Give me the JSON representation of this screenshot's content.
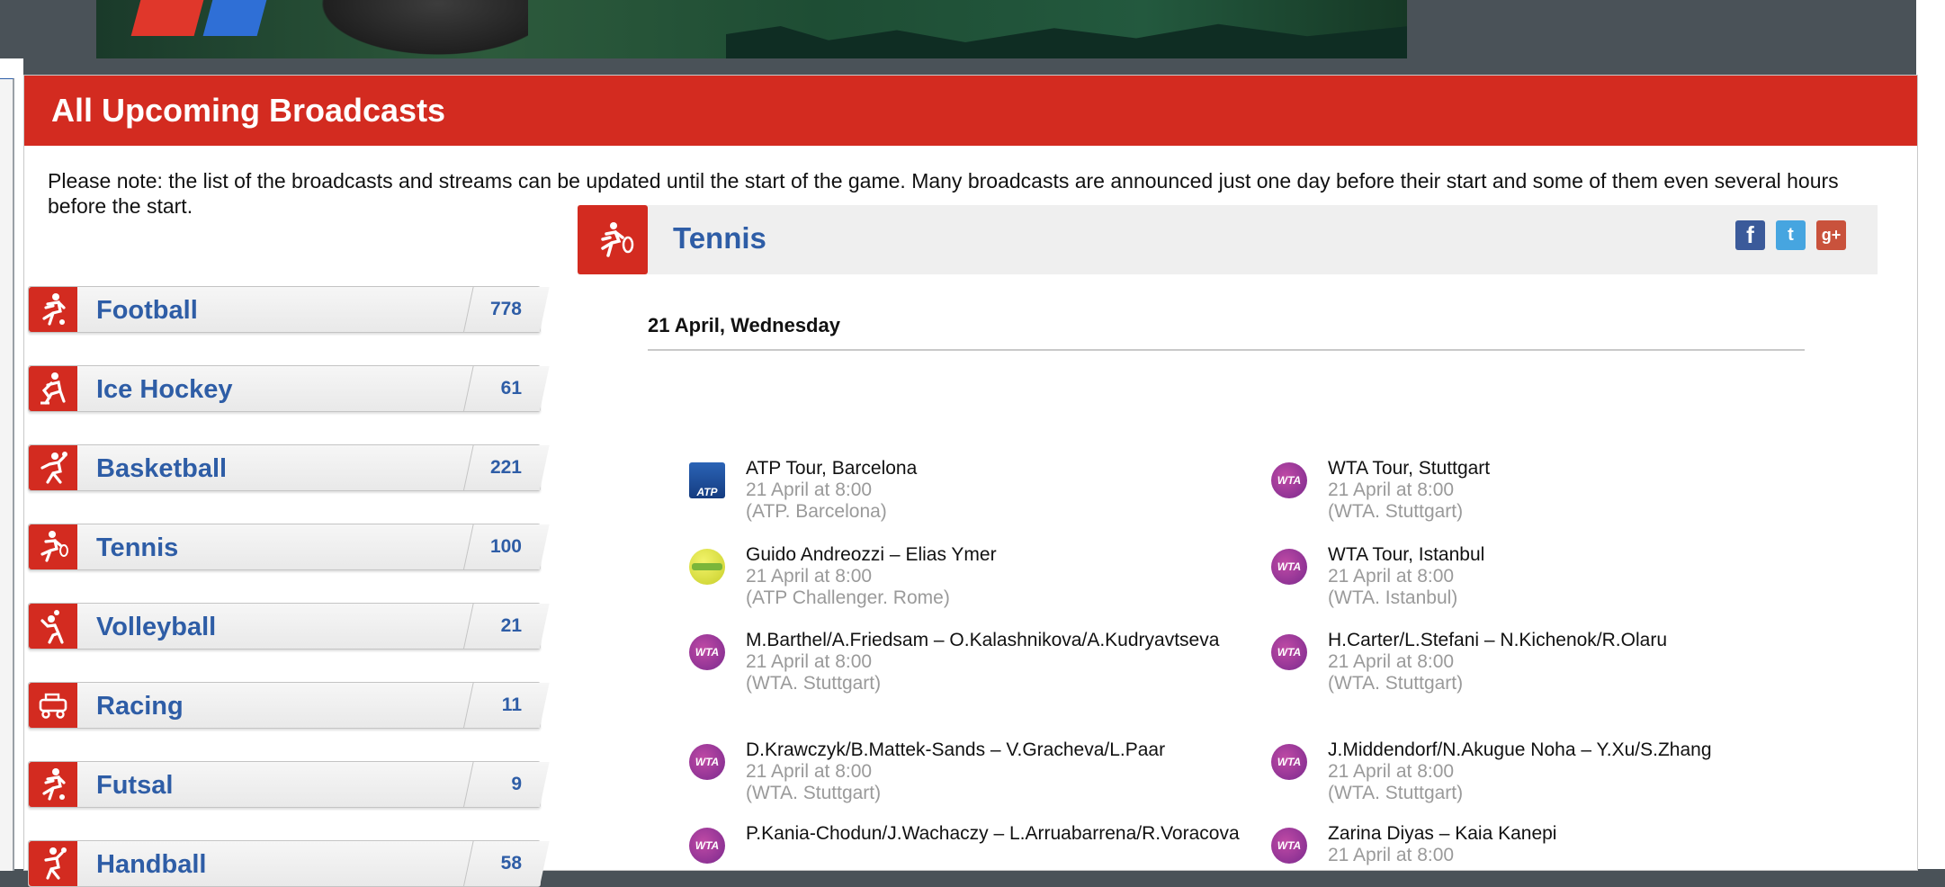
{
  "panel": {
    "title": "All Upcoming Broadcasts",
    "notice": "Please note: the list of the broadcasts and streams can be updated until the start of the game. Many broadcasts are announced just one day before their start and some of them even several hours before the start."
  },
  "sidebar": {
    "items": [
      {
        "label": "Football",
        "count": "778",
        "icon": "football-icon"
      },
      {
        "label": "Ice Hockey",
        "count": "61",
        "icon": "ice-hockey-icon"
      },
      {
        "label": "Basketball",
        "count": "221",
        "icon": "basketball-icon"
      },
      {
        "label": "Tennis",
        "count": "100",
        "icon": "tennis-icon"
      },
      {
        "label": "Volleyball",
        "count": "21",
        "icon": "volleyball-icon"
      },
      {
        "label": "Racing",
        "count": "11",
        "icon": "racing-icon"
      },
      {
        "label": "Futsal",
        "count": "9",
        "icon": "futsal-icon"
      },
      {
        "label": "Handball",
        "count": "58",
        "icon": "handball-icon"
      }
    ]
  },
  "section": {
    "title": "Tennis",
    "share": {
      "facebook": "f",
      "twitter": "t",
      "google_plus": "g+"
    },
    "day": "21 April, Wednesday",
    "events": [
      {
        "logo": "atp",
        "logo_text": "ATP",
        "title": "ATP Tour, Barcelona",
        "time": "21 April at 8:00",
        "league": "(ATP. Barcelona)"
      },
      {
        "logo": "wta",
        "logo_text": "WTA",
        "title": "WTA Tour, Stuttgart",
        "time": "21 April at 8:00",
        "league": "(WTA. Stuttgart)"
      },
      {
        "logo": "ball",
        "logo_text": "",
        "title": "Guido Andreozzi – Elias Ymer",
        "time": "21 April at 8:00",
        "league": "(ATP Challenger. Rome)"
      },
      {
        "logo": "wta",
        "logo_text": "WTA",
        "title": "WTA Tour, Istanbul",
        "time": "21 April at 8:00",
        "league": "(WTA. Istanbul)"
      },
      {
        "logo": "wta",
        "logo_text": "WTA",
        "title": "M.Barthel/A.Friedsam – O.Kalashnikova/A.Kudryavtseva",
        "time": "21 April at 8:00",
        "league": "(WTA. Stuttgart)"
      },
      {
        "logo": "wta",
        "logo_text": "WTA",
        "title": "H.Carter/L.Stefani – N.Kichenok/R.Olaru",
        "time": "21 April at 8:00",
        "league": "(WTA. Stuttgart)"
      },
      {
        "logo": "wta",
        "logo_text": "WTA",
        "title": "D.Krawczyk/B.Mattek-Sands – V.Gracheva/L.Paar",
        "time": "21 April at 8:00",
        "league": "(WTA. Stuttgart)"
      },
      {
        "logo": "wta",
        "logo_text": "WTA",
        "title": "J.Middendorf/N.Akugue Noha – Y.Xu/S.Zhang",
        "time": "21 April at 8:00",
        "league": "(WTA. Stuttgart)"
      },
      {
        "logo": "wta",
        "logo_text": "WTA",
        "title": "P.Kania-Chodun/J.Wachaczy – L.Arruabarrena/R.Voracova",
        "time": "",
        "league": ""
      },
      {
        "logo": "wta",
        "logo_text": "WTA",
        "title": "Zarina Diyas – Kaia Kanepi",
        "time": "21 April at 8:00",
        "league": ""
      }
    ]
  },
  "colors": {
    "accent_red": "#d32b20",
    "link_blue": "#2e5da6",
    "muted_gray": "#9a9a9a"
  }
}
